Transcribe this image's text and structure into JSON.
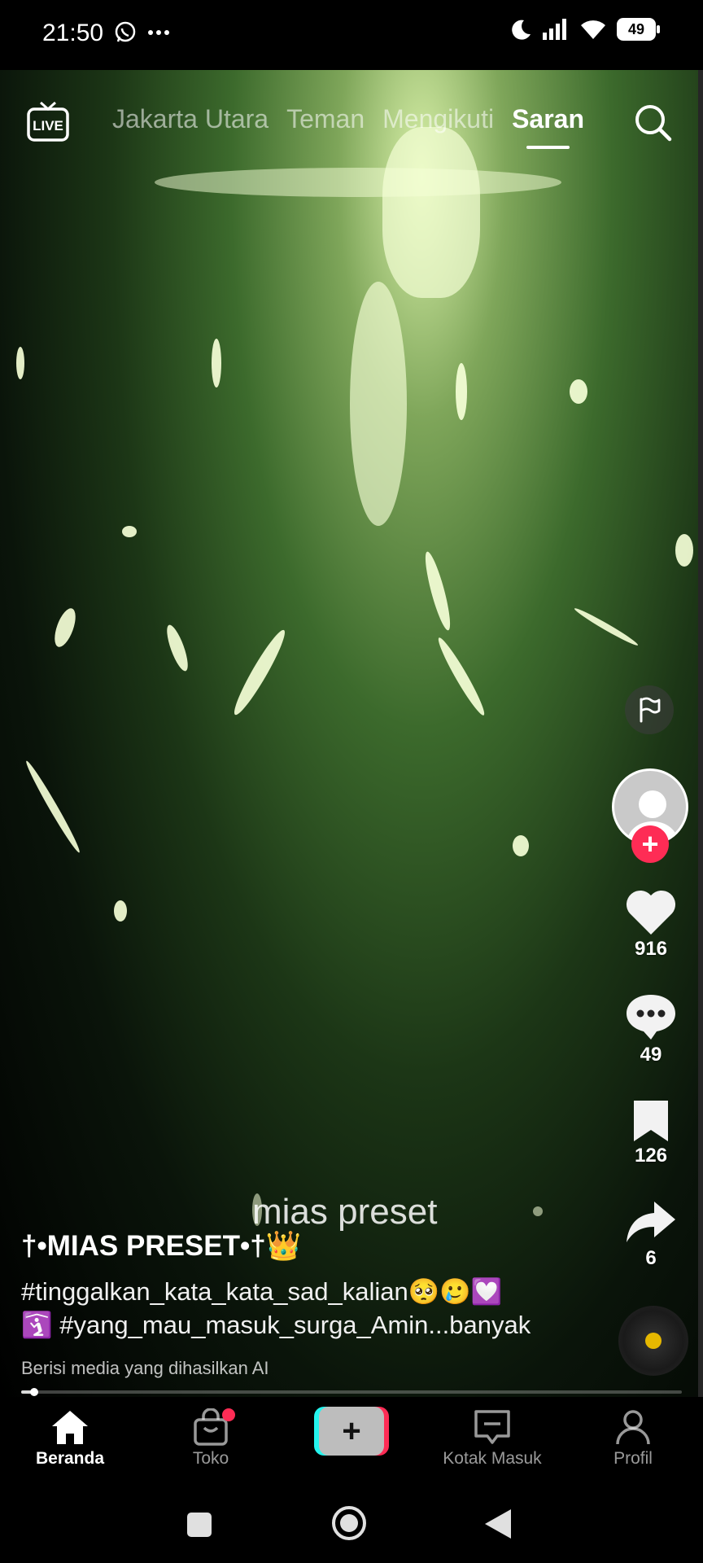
{
  "status_bar": {
    "time": "21:50",
    "battery": "49",
    "icons": [
      "whatsapp-icon",
      "more-icon",
      "moon-icon",
      "signal-icon",
      "wifi-icon",
      "battery-icon"
    ]
  },
  "top_nav": {
    "live_label": "LIVE",
    "tabs": [
      {
        "label": "Jakarta Utara",
        "active": false
      },
      {
        "label": "Teman",
        "active": false
      },
      {
        "label": "Mengikuti",
        "active": false
      },
      {
        "label": "Saran",
        "active": true
      }
    ]
  },
  "video": {
    "watermark": "mias preset"
  },
  "actions": {
    "likes": "916",
    "comments": "49",
    "bookmarks": "126",
    "shares": "6"
  },
  "post": {
    "author": "†•MIAS PRESET•†👑",
    "caption_line1": "#tinggalkan_kata_kata_sad_kalian🥺🥲💟",
    "caption_line2": "🛐 #yang_mau_masuk_surga_Amin...banyak",
    "ai_label": "Berisi media yang dihasilkan AI",
    "progress": 0.02
  },
  "bottom_nav": [
    {
      "label": "Beranda",
      "active": true
    },
    {
      "label": "Toko",
      "active": false
    },
    {
      "label": "Kotak Masuk",
      "active": false
    },
    {
      "label": "Profil",
      "active": false
    }
  ],
  "colors": {
    "accent": "#fe2c55",
    "cyan": "#25f4ee",
    "music": "#e6b800"
  }
}
